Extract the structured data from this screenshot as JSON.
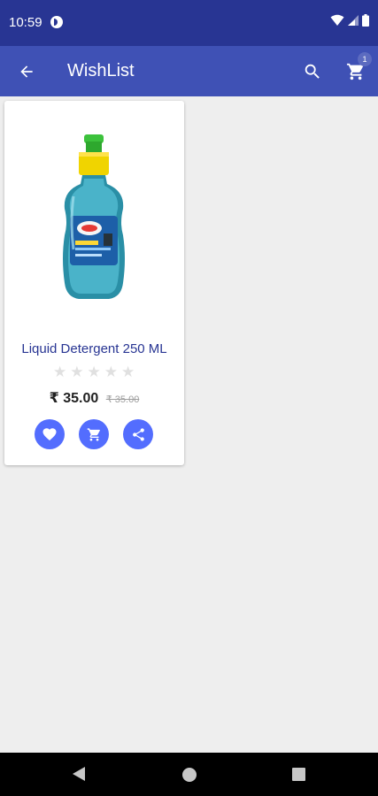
{
  "status_bar": {
    "time": "10:59"
  },
  "app_bar": {
    "title": "WishList",
    "cart_badge": "1"
  },
  "product": {
    "name": "Liquid Detergent 250 ML",
    "rating": 0,
    "rating_max": 5,
    "price": "₹ 35.00",
    "old_price": "₹ 35.00"
  },
  "colors": {
    "status_bar": "#283593",
    "app_bar": "#3f51b5",
    "accent": "#536dfe",
    "product_name": "#283593"
  }
}
